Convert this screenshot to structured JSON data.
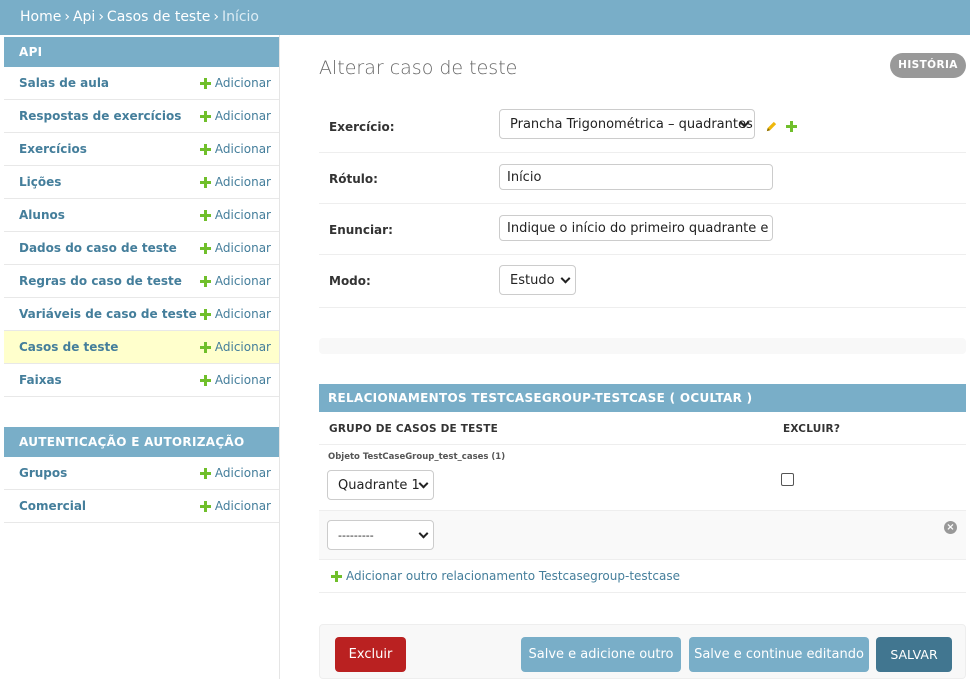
{
  "breadcrumbs": {
    "home": "Home",
    "app": "Api",
    "model": "Casos de teste",
    "current": "Início",
    "separator": "›"
  },
  "sidebar": {
    "modules": [
      {
        "caption": "API",
        "items": [
          {
            "label": "Salas de aula",
            "add": "Adicionar"
          },
          {
            "label": "Respostas de exercícios",
            "add": "Adicionar"
          },
          {
            "label": "Exercícios",
            "add": "Adicionar"
          },
          {
            "label": "Lições",
            "add": "Adicionar"
          },
          {
            "label": "Alunos",
            "add": "Adicionar"
          },
          {
            "label": "Dados do caso de teste",
            "add": "Adicionar"
          },
          {
            "label": "Regras do caso de teste",
            "add": "Adicionar"
          },
          {
            "label": "Variáveis de caso de teste",
            "add": "Adicionar"
          },
          {
            "label": "Casos de teste",
            "add": "Adicionar",
            "active": true
          },
          {
            "label": "Faixas",
            "add": "Adicionar"
          }
        ]
      },
      {
        "caption": "AUTENTICAÇÃO E AUTORIZAÇÃO",
        "items": [
          {
            "label": "Grupos",
            "add": "Adicionar"
          },
          {
            "label": "Comercial",
            "add": "Adicionar"
          }
        ]
      }
    ]
  },
  "main": {
    "title": "Alterar caso de teste",
    "history": "HISTÓRIA",
    "fields": {
      "exercicio": {
        "label": "Exercício:",
        "value": "Prancha Trigonométrica – quadrantes"
      },
      "rotulo": {
        "label": "Rótulo:",
        "value": "Início"
      },
      "enunciar": {
        "label": "Enunciar:",
        "value": "Indique o início do primeiro quadrante e inform"
      },
      "modo": {
        "label": "Modo:",
        "value": "Estudo"
      }
    },
    "inline": {
      "heading": "RELACIONAMENTOS TESTCASEGROUP-TESTCASE",
      "toggle": "( OCULTAR )",
      "col_group": "GRUPO DE CASOS DE TESTE",
      "col_delete": "EXCLUIR?",
      "row1_label": "Objeto TestCaseGroup_test_cases (1)",
      "row1_value": "Quadrante 1",
      "row2_value": "---------",
      "add_another": "Adicionar outro relacionamento Testcasegroup-testcase"
    },
    "submit": {
      "delete": "Excluir",
      "save_add": "Salve e adicione outro",
      "save_continue": "Salve e continue editando",
      "save": "SALVAR"
    }
  },
  "colors": {
    "header": "#79aec8",
    "link": "#447e9b",
    "add_green": "#70bf2b",
    "delete_red": "#ba2121",
    "save_dark": "#417690",
    "active_row": "#ffffcc"
  }
}
